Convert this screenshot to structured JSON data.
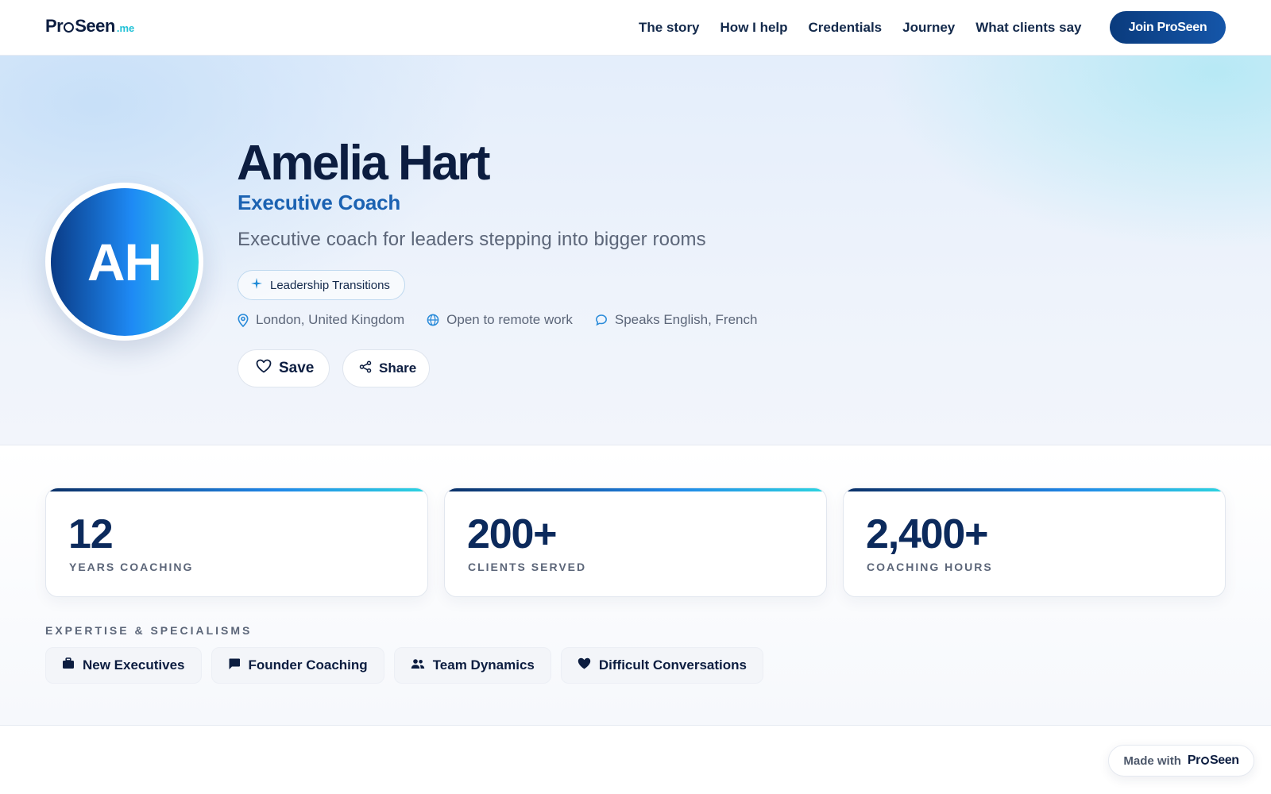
{
  "brand": {
    "logo_pre": "Pr",
    "logo_post": "Seen",
    "logo_tld": ".me"
  },
  "nav": {
    "links": [
      "The story",
      "How I help",
      "Credentials",
      "Journey",
      "What clients say"
    ],
    "cta_label": "Join ProSeen"
  },
  "profile": {
    "initials": "AH",
    "name": "Amelia Hart",
    "role": "Executive Coach",
    "tagline": "Executive coach for leaders stepping into bigger rooms",
    "tag": "Leadership Transitions",
    "location": "London, United Kingdom",
    "remote": "Open to remote work",
    "languages": "Speaks English, French",
    "save_label": "Save",
    "share_label": "Share"
  },
  "stats": [
    {
      "value": "12",
      "label": "YEARS COACHING"
    },
    {
      "value": "200+",
      "label": "CLIENTS SERVED"
    },
    {
      "value": "2,400+",
      "label": "COACHING HOURS"
    }
  ],
  "expertise": {
    "heading": "EXPERTISE & SPECIALISMS",
    "chips": [
      {
        "label": "New Executives",
        "icon": "briefcase-icon"
      },
      {
        "label": "Founder Coaching",
        "icon": "chat-icon"
      },
      {
        "label": "Team Dynamics",
        "icon": "people-icon"
      },
      {
        "label": "Difficult Conversations",
        "icon": "heart-icon"
      }
    ]
  },
  "badge": {
    "made_with": "Made with",
    "logo_pre": "Pr",
    "logo_post": "Seen"
  },
  "colors": {
    "navy": "#0c1d40",
    "accent_blue": "#1b62b2",
    "cyan": "#2cd4e0"
  }
}
